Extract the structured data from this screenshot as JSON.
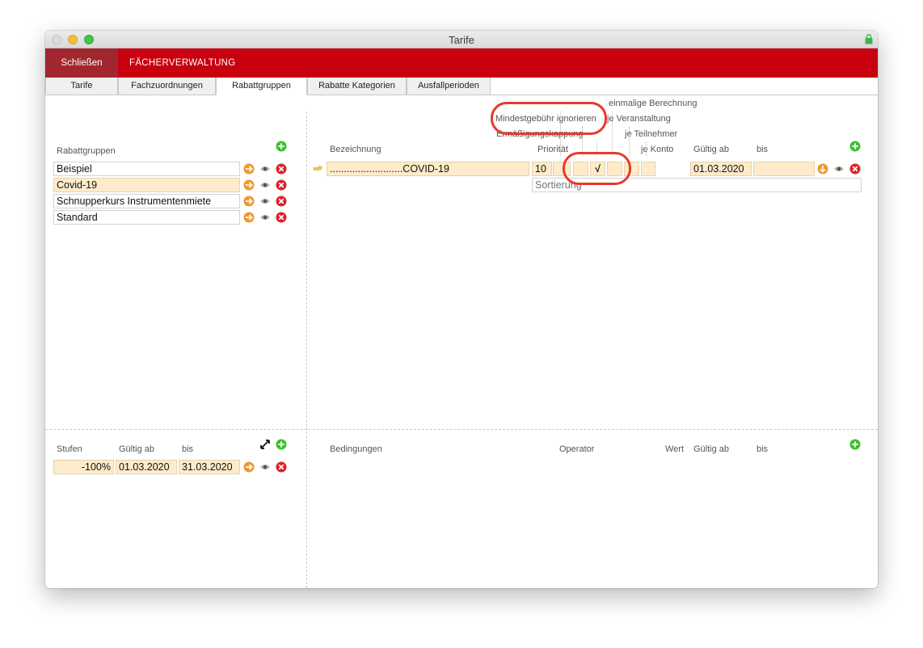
{
  "window": {
    "title": "Tarife"
  },
  "menu": {
    "close_label": "Schließen",
    "section_label": "FÄCHERVERWALTUNG"
  },
  "tabs": [
    {
      "label": "Tarife"
    },
    {
      "label": "Fachzuordnungen"
    },
    {
      "label": "Rabattgruppen"
    },
    {
      "label": "Rabatte Kategorien"
    },
    {
      "label": "Ausfallperioden"
    }
  ],
  "groups": {
    "header": "Rabattgruppen",
    "items": [
      {
        "name": "Beispiel"
      },
      {
        "name": "Covid-19"
      },
      {
        "name": "Schnupperkurs Instrumentenmiete"
      },
      {
        "name": "Standard"
      }
    ]
  },
  "discount": {
    "headers": {
      "bezeichnung": "Bezeichnung",
      "prioritaet": "Priorität",
      "kappung": "Ermäßigungskappung",
      "mindestgebuehr": "Mindestgebühr ignorieren",
      "einmalig": "einmalige Berechnung",
      "je_veranstaltung": "je Veranstaltung",
      "je_teilnehmer": "je Teilnehmer",
      "je_konto": "je Konto",
      "gueltig_ab": "Gültig ab",
      "bis": "bis"
    },
    "row": {
      "name": "..........................COVID-19",
      "priority": "10",
      "check": "√",
      "valid_from": "01.03.2020",
      "valid_to": ""
    },
    "sort_placeholder": "Sortierung"
  },
  "stufen": {
    "headers": {
      "stufen": "Stufen",
      "gueltig_ab": "Gültig ab",
      "bis": "bis"
    },
    "row": {
      "value": "-100%",
      "from": "01.03.2020",
      "to": "31.03.2020"
    }
  },
  "conditions": {
    "headers": {
      "bedingungen": "Bedingungen",
      "operator": "Operator",
      "wert": "Wert",
      "gueltig_ab": "Gültig ab",
      "bis": "bis"
    }
  },
  "colors": {
    "menubar": "#c8000f",
    "close_button": "#a2262e",
    "highlight_field": "#fdebc9",
    "arrow_orange": "#f0982c",
    "delete_red": "#e0202a",
    "add_green": "#3cc22c",
    "annotation": "#e8392d"
  }
}
